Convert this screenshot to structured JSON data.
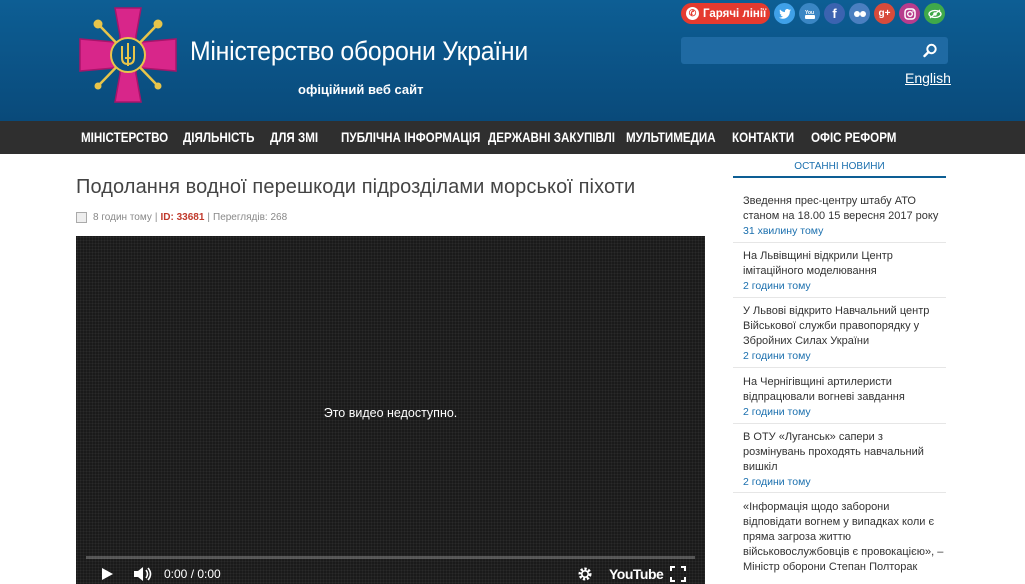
{
  "header": {
    "site_title": "Міністерство оборони України",
    "site_subtitle": "офіційний веб сайт",
    "hotline_label": "Гарячі лінії",
    "language_link": "English",
    "search": {
      "placeholder": "",
      "value": ""
    },
    "social": [
      {
        "icon": "twitter-icon",
        "color": "#3fa0e8",
        "glyph": "t"
      },
      {
        "icon": "youtube-icon",
        "color": "#3a86c4",
        "glyph": "▶"
      },
      {
        "icon": "facebook-icon",
        "color": "#3b63b0",
        "glyph": "f"
      },
      {
        "icon": "flickr-icon",
        "color": "#4a7fc0",
        "glyph": "••"
      },
      {
        "icon": "google-plus-icon",
        "color": "#d84b3b",
        "glyph": "g+"
      },
      {
        "icon": "instagram-icon",
        "color": "#b83c8d",
        "glyph": "◎"
      },
      {
        "icon": "accessibility-eye-icon",
        "color": "#3fa94a",
        "glyph": "◉"
      }
    ],
    "colors": {
      "header_bg": "#0b5285",
      "nav_bg": "#2f2f2f",
      "hotline_bg": "#e53a2f",
      "logo_cross": "#d8268a",
      "accent_link": "#1a6fae"
    }
  },
  "nav": {
    "items": [
      "МІНІСТЕРСТВО",
      "ДІЯЛЬНІСТЬ",
      "ДЛЯ ЗМІ",
      "ПУБЛІЧНА ІНФОРМАЦІЯ",
      "ДЕРЖАВНІ ЗАКУПІВЛІ",
      "МУЛЬТИМЕДИА",
      "КОНТАКТИ",
      "ОФІС РЕФОРМ"
    ]
  },
  "article": {
    "title": "Подолання водної перешкоди підрозділами морської піхоти",
    "meta": {
      "date": "8 годин тому",
      "separator": "|",
      "id_label": "ID: 33681",
      "views": "Переглядів: 268"
    },
    "video": {
      "unavailable_message": "Это видео недоступно.",
      "time": "0:00 / 0:00",
      "brand": "YouTube"
    }
  },
  "sidebar": {
    "heading": "ОСТАННІ НОВИНИ",
    "news": [
      {
        "title": "Зведення прес-центру штабу АТО станом на 18.00 15 вересня 2017 року",
        "time": "31 хвилину тому"
      },
      {
        "title": "На Львівщині відкрили Центр імітаційного моделювання",
        "time": "2 години тому"
      },
      {
        "title": "У Львові відкрито Навчальний центр Військової служби правопорядку у Збройних Силах України",
        "time": "2 години тому"
      },
      {
        "title": "На Чернігівщині артилеристи відпрацювали вогневі завдання",
        "time": "2 години тому"
      },
      {
        "title": "В ОТУ «Луганськ» сапери з розмінувань проходять навчальний вишкіл",
        "time": "2 години тому"
      },
      {
        "title": "«Інформація щодо заборони відповідати вогнем у випадках коли є пряма загроза життю військовослужбовців є провокацією», – Міністр оборони Степан Полторак",
        "time": ""
      }
    ]
  }
}
